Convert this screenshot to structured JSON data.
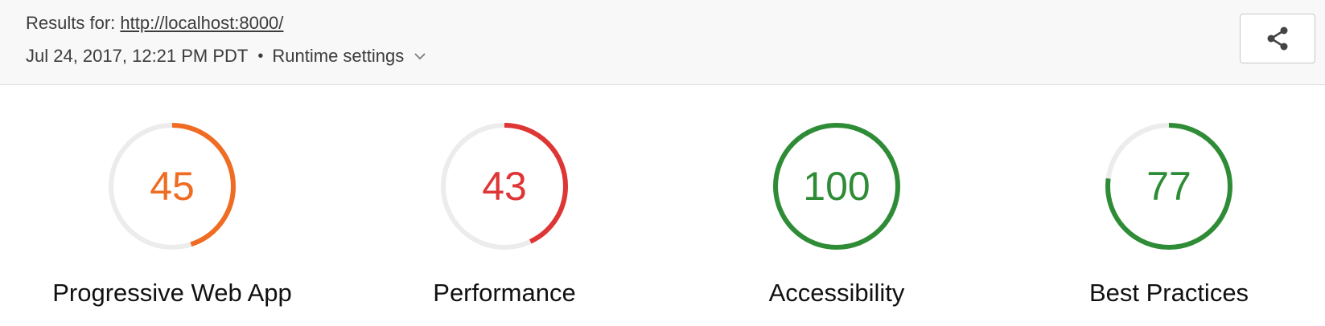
{
  "header": {
    "results_prefix": "Results for: ",
    "url": "http://localhost:8000/",
    "timestamp": "Jul 24, 2017, 12:21 PM PDT",
    "separator": "•",
    "runtime_settings_label": "Runtime settings",
    "runtime_icon": "chevron-down-icon",
    "share_icon": "share-icon"
  },
  "gauges": [
    {
      "score": "45",
      "value": 45,
      "label": "Progressive Web App",
      "color": "#ef6c22"
    },
    {
      "score": "43",
      "value": 43,
      "label": "Performance",
      "color": "#de3535"
    },
    {
      "score": "100",
      "value": 100,
      "label": "Accessibility",
      "color": "#2f8c36"
    },
    {
      "score": "77",
      "value": 77,
      "label": "Best Practices",
      "color": "#2f8c36"
    }
  ],
  "colors": {
    "track": "#ececec",
    "header_bg": "#f8f8f8"
  }
}
